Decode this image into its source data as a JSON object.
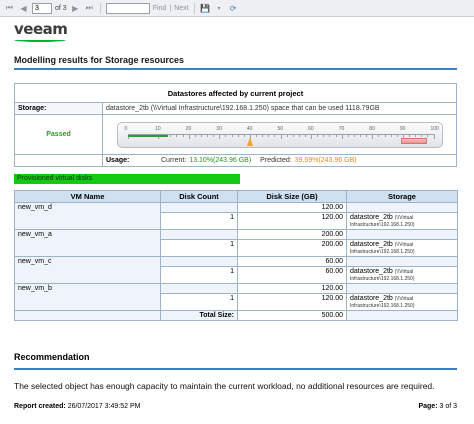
{
  "toolbar": {
    "page_value": "3",
    "of_text": "of 3",
    "find_label": "Find",
    "next_label": "Next",
    "separator": "|"
  },
  "logo": {
    "text": "veeam"
  },
  "report": {
    "title": "Modelling results for Storage resources",
    "section_title": "Datastores affected by current project",
    "storage_label": "Storage:",
    "storage_value": "datastore_2tb (\\\\Virtual Infrastructure\\192.168.1.250) space that can be used 1118.79GB",
    "status": "Passed",
    "gauge_ticks": [
      "0",
      "10",
      "20",
      "30",
      "40",
      "50",
      "60",
      "70",
      "80",
      "90",
      "100"
    ],
    "gauge_current_fraction": 0.131,
    "gauge_predicted_fraction": 0.399,
    "usage_label": "Usage:",
    "usage_current_label": "Current:",
    "usage_current_value": "13.10%(243.96 GB)",
    "usage_predicted_label": "Predicted:",
    "usage_predicted_value": "39.69%(243.96 GB)"
  },
  "provisioned": {
    "label": "Provisioned virtual disks"
  },
  "vm_table": {
    "headers": [
      "VM Name",
      "Disk Count",
      "Disk Size (GB)",
      "Storage"
    ],
    "rows": [
      {
        "vm": "new_vm_d",
        "total": "120.00",
        "count": "1",
        "size": "120.00",
        "ds": "datastore_2tb",
        "ds_path1": "(\\\\Virtual",
        "ds_path2": "Infrastructure\\192.168.1.250)"
      },
      {
        "vm": "new_vm_a",
        "total": "200.00",
        "count": "1",
        "size": "200.00",
        "ds": "datastore_2tb",
        "ds_path1": "(\\\\Virtual",
        "ds_path2": "Infrastructure\\192.168.1.250)"
      },
      {
        "vm": "new_vm_c",
        "total": "60.00",
        "count": "1",
        "size": "60.00",
        "ds": "datastore_2tb",
        "ds_path1": "(\\\\Virtual",
        "ds_path2": "Infrastructure\\192.168.1.250)"
      },
      {
        "vm": "new_vm_b",
        "total": "120.00",
        "count": "1",
        "size": "120.00",
        "ds": "datastore_2tb",
        "ds_path1": "(\\\\Virtual",
        "ds_path2": "Infrastructure\\192.168.1.250)"
      }
    ],
    "total_label": "Total Size:",
    "total_value": "500.00"
  },
  "recommendation": {
    "title": "Recommendation",
    "text": "The selected object has enough capacity to maintain the current workload, no additional resources are required."
  },
  "footer": {
    "created_label": "Report created:",
    "created_value": "26/07/2017 3:49:52 PM",
    "page_label": "Page:",
    "page_value": "3 of 3"
  },
  "colors": {
    "accent_blue": "#3b7ec2",
    "passed_green": "#2e9a2e",
    "provisioned_green": "#14c814",
    "predicted_orange": "#e58a12"
  }
}
